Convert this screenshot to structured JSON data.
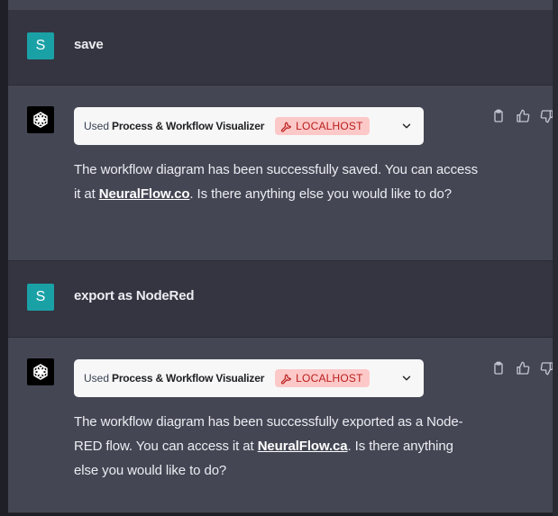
{
  "messages": [
    {
      "role": "user",
      "avatar": "S",
      "text": "save"
    },
    {
      "role": "assistant",
      "tool": {
        "used_label": "Used",
        "name": "Process & Workflow Visualizer",
        "badge": "LOCALHOST"
      },
      "text_before": "The workflow diagram has been successfully saved. You can access it at ",
      "link": "NeuralFlow.co",
      "text_after": ". Is there anything else you would like to do?"
    },
    {
      "role": "user",
      "avatar": "S",
      "text": "export as NodeRed"
    },
    {
      "role": "assistant",
      "tool": {
        "used_label": "Used",
        "name": "Process & Workflow Visualizer",
        "badge": "LOCALHOST"
      },
      "text_before": "The workflow diagram has been successfully exported as a Node-RED flow. You can access it at ",
      "link": "NeuralFlow.ca",
      "text_after": ". Is there anything else you would like to do?"
    }
  ],
  "icons": [
    "openai-logo-icon",
    "wrench-icon",
    "chevron-down-icon",
    "clipboard-icon",
    "thumbs-up-icon",
    "thumbs-down-icon"
  ],
  "colors": {
    "user_avatar": "#1aa1a6",
    "badge_bg": "#fcc9c8",
    "badge_text": "#b91c1c"
  }
}
